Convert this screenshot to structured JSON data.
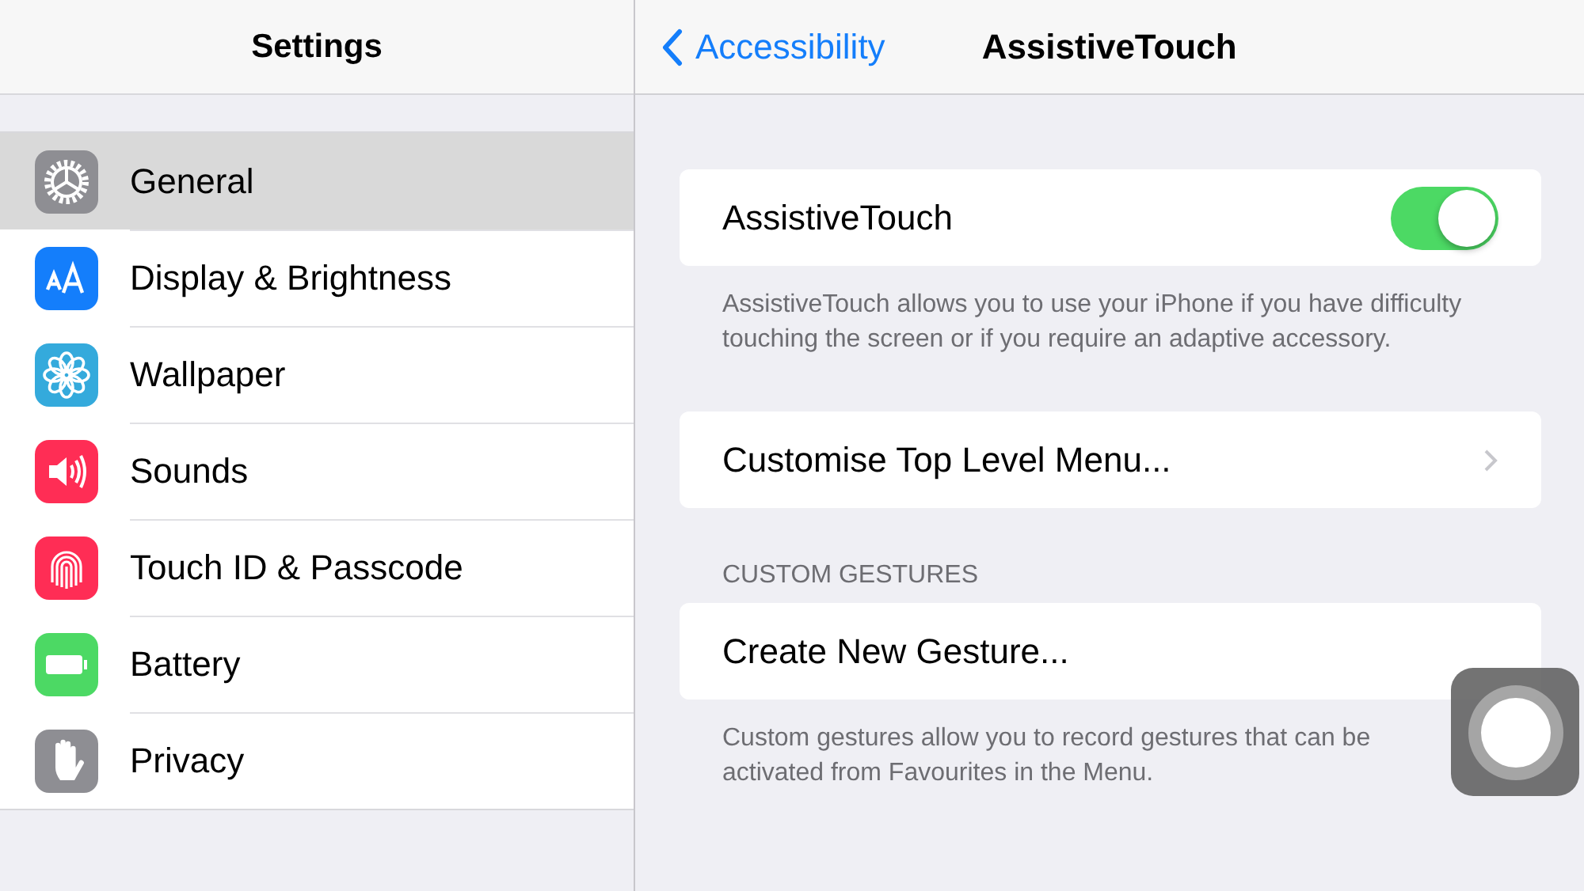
{
  "sidebar": {
    "title": "Settings",
    "items": [
      {
        "label": "General",
        "kind": "gear",
        "color": "#8e8e93",
        "selected": true
      },
      {
        "label": "Display & Brightness",
        "kind": "text-size",
        "color": "#147efb",
        "selected": false
      },
      {
        "label": "Wallpaper",
        "kind": "flower",
        "color": "#34aadc",
        "selected": false
      },
      {
        "label": "Sounds",
        "kind": "speaker",
        "color": "#ff2d55",
        "selected": false
      },
      {
        "label": "Touch ID & Passcode",
        "kind": "fingerprint",
        "color": "#ff2d55",
        "selected": false
      },
      {
        "label": "Battery",
        "kind": "battery",
        "color": "#4cd964",
        "selected": false
      },
      {
        "label": "Privacy",
        "kind": "hand",
        "color": "#8e8e93",
        "selected": false
      }
    ]
  },
  "nav": {
    "back": "Accessibility",
    "title": "AssistiveTouch"
  },
  "groups": [
    {
      "rows": [
        {
          "kind": "toggle",
          "label": "AssistiveTouch",
          "on": true
        }
      ],
      "footer": "AssistiveTouch allows you to use your iPhone if you have difficulty touching the screen or if you require an adaptive accessory."
    },
    {
      "rows": [
        {
          "kind": "link",
          "label": "Customise Top Level Menu..."
        }
      ]
    },
    {
      "header": "CUSTOM GESTURES",
      "rows": [
        {
          "kind": "action",
          "label": "Create New Gesture..."
        }
      ],
      "footer": "Custom gestures allow you to record gestures that can be activated from Favourites in the Menu."
    }
  ]
}
